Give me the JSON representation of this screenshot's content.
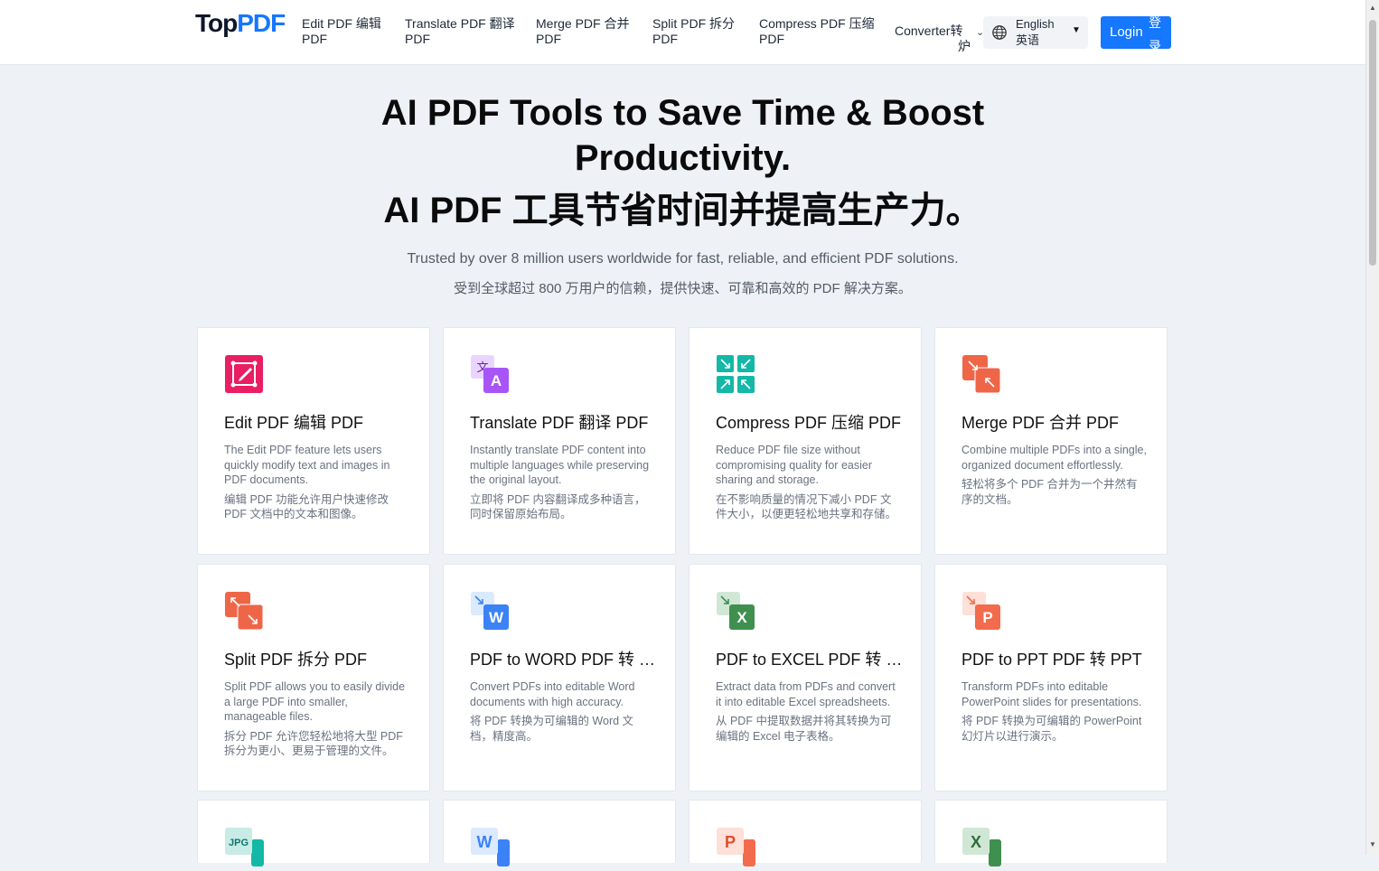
{
  "header": {
    "logo_top": "Top",
    "logo_pdf": "PDF",
    "nav": [
      {
        "line1": "Edit PDF 编辑",
        "line2": "PDF"
      },
      {
        "line1": "Translate PDF 翻译",
        "line2": "PDF"
      },
      {
        "line1": "Merge PDF 合并",
        "line2": "PDF"
      },
      {
        "line1": "Split PDF 拆分",
        "line2": "PDF"
      },
      {
        "line1": "Compress PDF 压缩",
        "line2": "PDF"
      }
    ],
    "converter_line1": "Converter转",
    "converter_line2": "炉",
    "language_line1": "English",
    "language_line2": "英语",
    "login_label": "Login",
    "login_cn": "登录"
  },
  "hero": {
    "title_line1": "AI PDF Tools to Save Time & Boost",
    "title_line2": "Productivity.",
    "title_line3": "AI PDF 工具节省时间并提高生产力。",
    "subtitle": "Trusted by over 8 million users worldwide for fast, reliable, and efficient PDF solutions.",
    "subtitle_cn": "受到全球超过 800 万用户的信赖，提供快速、可靠和高效的 PDF 解决方案。"
  },
  "cards": [
    {
      "title": "Edit PDF  编辑 PDF",
      "desc": "The Edit PDF feature lets users quickly modify text and images in PDF documents.",
      "desc_cn": "编辑 PDF 功能允许用户快速修改 PDF 文档中的文本和图像。",
      "icon": "edit-pdf-icon",
      "color": "#e91e63"
    },
    {
      "title": "Translate PDF  翻译 PDF",
      "desc": "Instantly translate PDF content into multiple languages while preserving the original layout.",
      "desc_cn": "立即将 PDF 内容翻译成多种语言，同时保留原始布局。",
      "icon": "translate-pdf-icon",
      "color": "#a855f7",
      "glyph_small": "文",
      "glyph_big": "A"
    },
    {
      "title": "Compress PDF  压缩 PDF",
      "desc": "Reduce PDF file size without compromising quality for easier sharing and storage.",
      "desc_cn": "在不影响质量的情况下减小 PDF 文件大小，以便更轻松地共享和存储。",
      "icon": "compress-pdf-icon",
      "color": "#14b8a6"
    },
    {
      "title": "Merge PDF  合并 PDF",
      "desc": "Combine multiple PDFs into a single, organized document effortlessly.",
      "desc_cn": "轻松将多个 PDF 合并为一个井然有序的文档。",
      "icon": "merge-pdf-icon",
      "color": "#ef6548"
    },
    {
      "title": "Split PDF  拆分 PDF",
      "desc": "Split PDF allows you to easily divide a large PDF into smaller, manageable files.",
      "desc_cn": "拆分 PDF 允许您轻松地将大型 PDF 拆分为更小、更易于管理的文件。",
      "icon": "split-pdf-icon",
      "color": "#ef6548"
    },
    {
      "title": "PDF to WORD  PDF 转 Word",
      "desc": "Convert PDFs into editable Word documents with high accuracy.",
      "desc_cn": "将 PDF 转换为可编辑的 Word 文档，精度高。",
      "icon": "pdf-to-word-icon",
      "color": "#3b82f6",
      "glyph_big": "W"
    },
    {
      "title": "PDF to EXCEL  PDF 转 Excel",
      "desc": "Extract data from PDFs and convert it into editable Excel spreadsheets.",
      "desc_cn": "从 PDF 中提取数据并将其转换为可编辑的 Excel 电子表格。",
      "icon": "pdf-to-excel-icon",
      "color": "#3f8f4f",
      "glyph_big": "X"
    },
    {
      "title": "PDF to PPT  PDF 转 PPT",
      "desc": "Transform PDFs into editable PowerPoint slides for presentations.",
      "desc_cn": "将 PDF 转换为可编辑的 PowerPoint 幻灯片以进行演示。",
      "icon": "pdf-to-ppt-icon",
      "color": "#f26b4d",
      "glyph_big": "P"
    }
  ],
  "partial_cards": [
    {
      "icon": "jpg-icon",
      "glyph": "JPG",
      "color": "#14b8a6"
    },
    {
      "icon": "word-icon",
      "glyph": "W",
      "color": "#3b82f6"
    },
    {
      "icon": "ppt-icon",
      "glyph": "P",
      "color": "#f26b4d"
    },
    {
      "icon": "excel-icon",
      "glyph": "X",
      "color": "#3f8f4f"
    }
  ]
}
